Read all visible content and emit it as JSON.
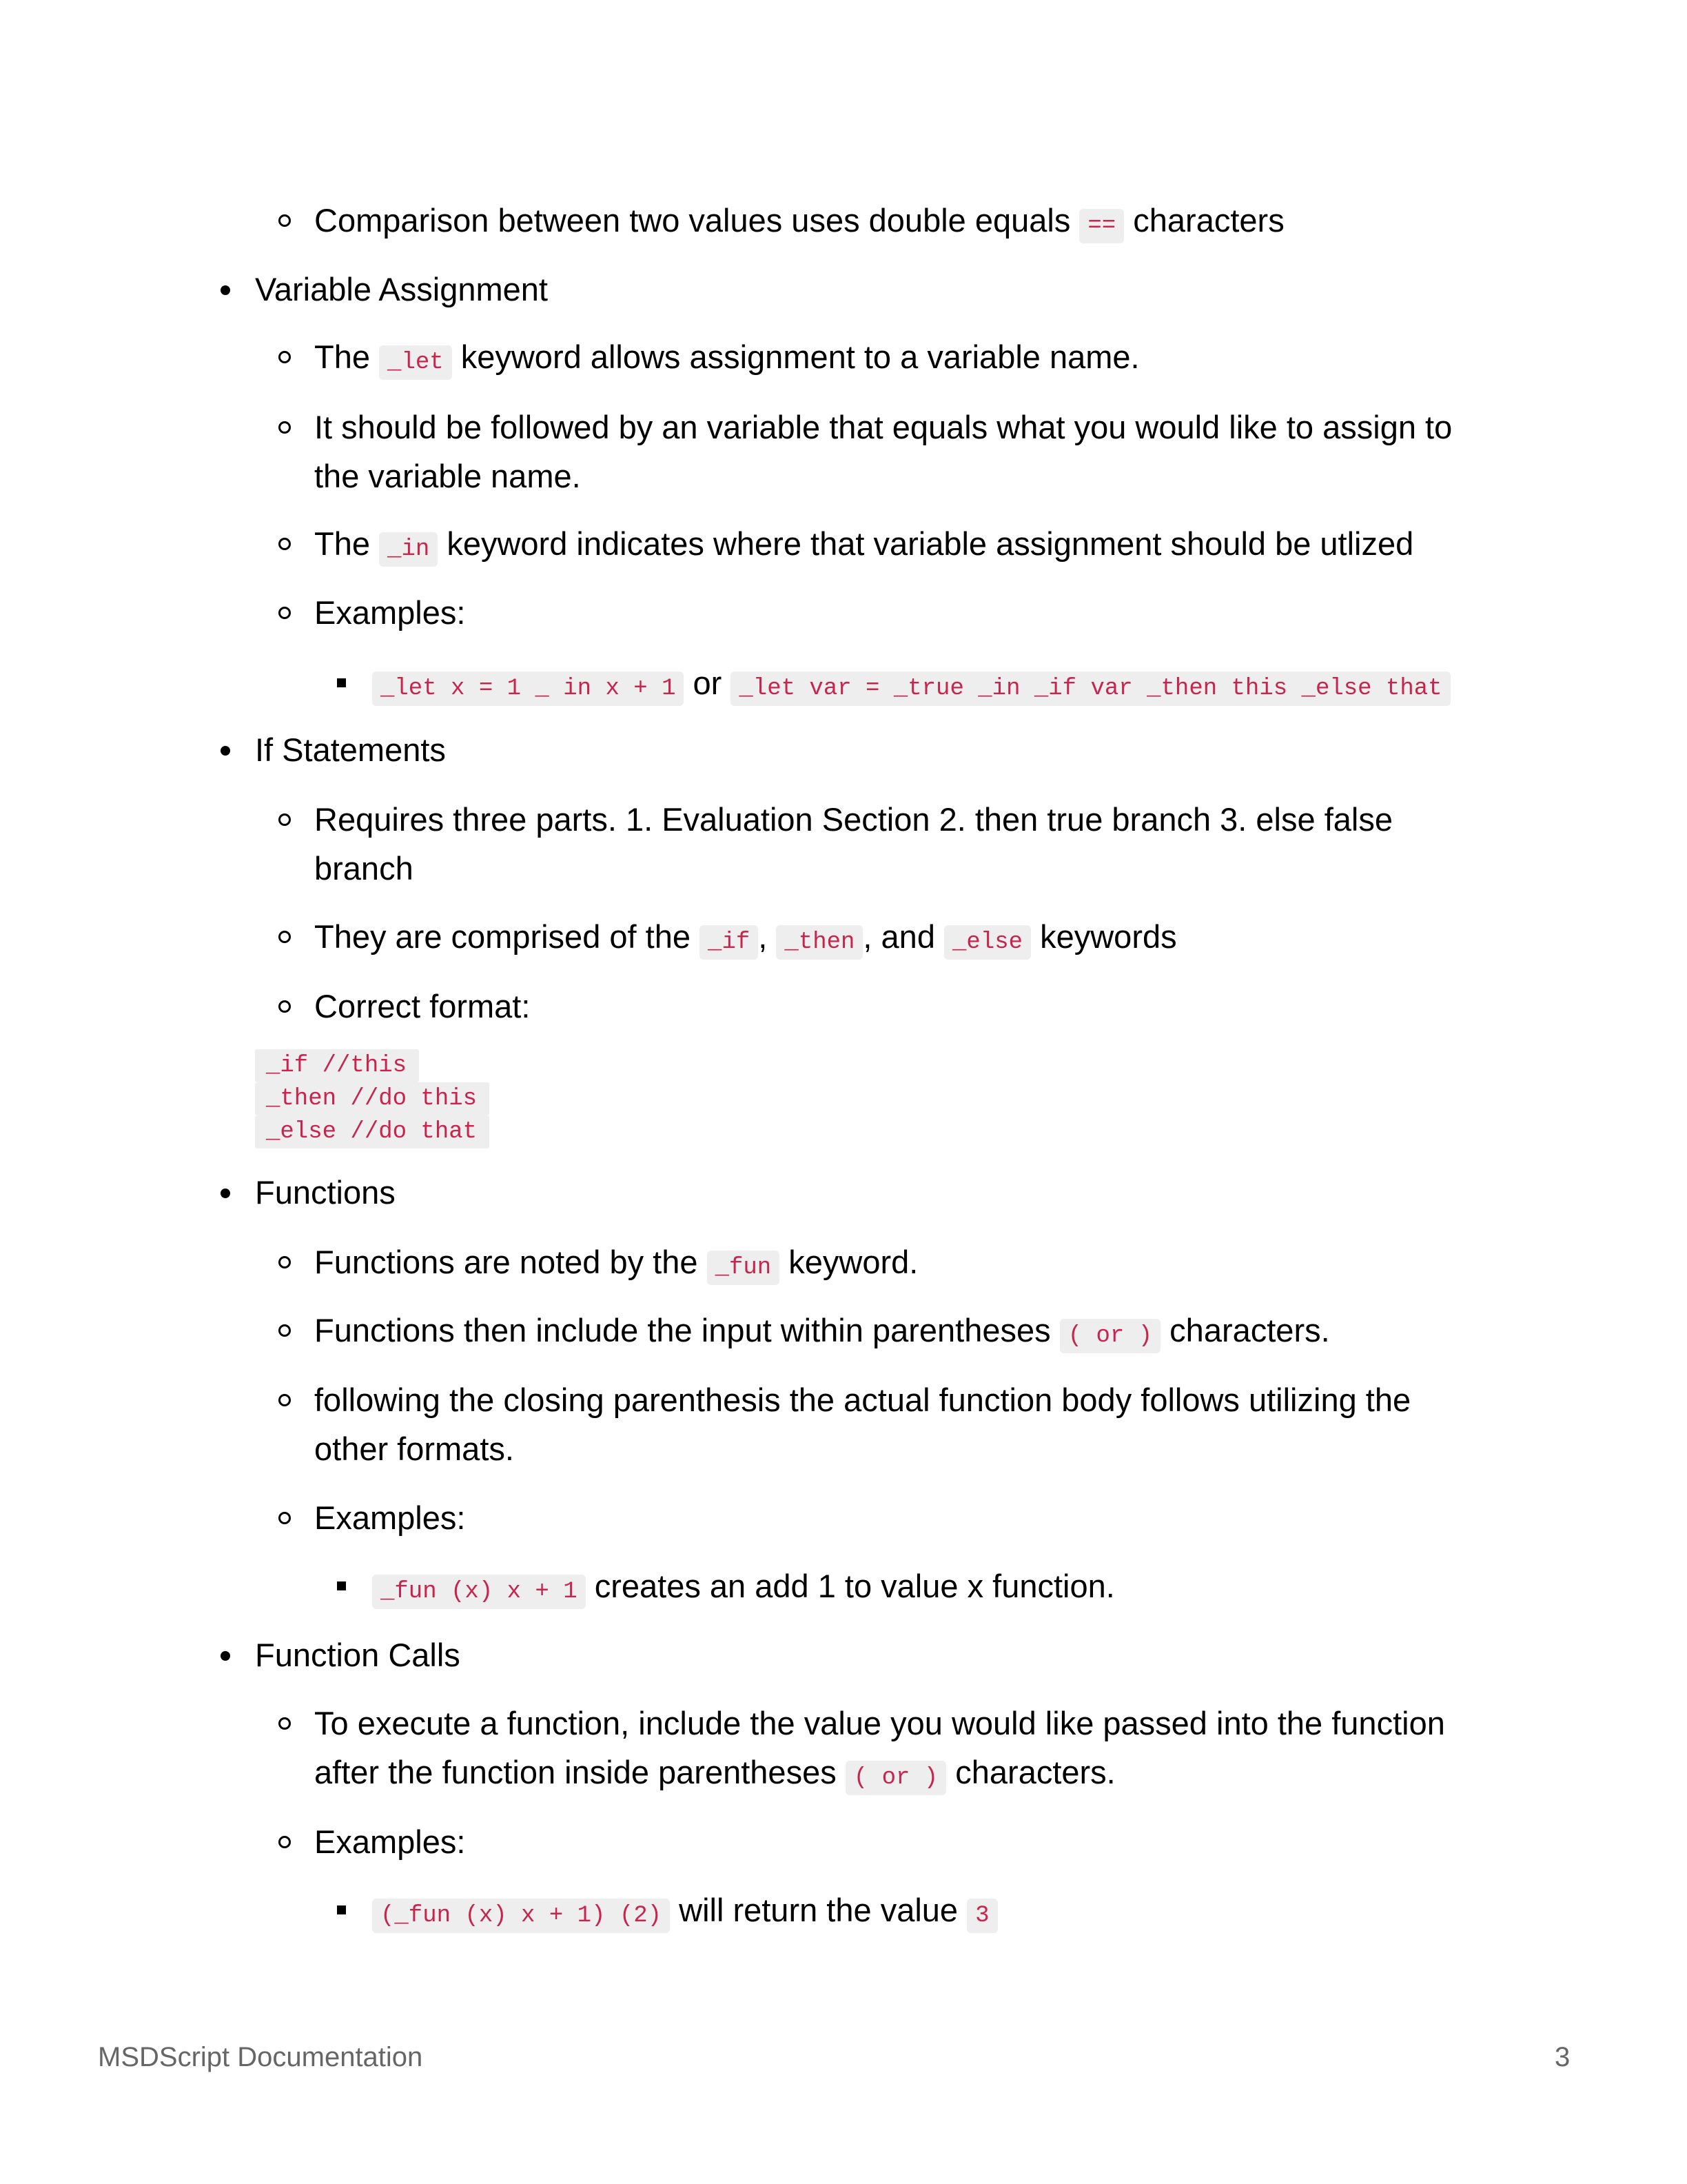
{
  "content": {
    "l1": {
      "a": "Comparison between two values uses double equals ",
      "code": "==",
      "b": " characters"
    },
    "l2": "Variable Assignment",
    "l3": {
      "a": "The ",
      "code": "_let",
      "b": " keyword allows assignment to a variable name."
    },
    "l4": "It should be followed by an variable that equals what you would like to assign to",
    "l5": "the variable name.",
    "l6": {
      "a": "The ",
      "code": "_in",
      "b": " keyword indicates where that variable assignment should be utlized"
    },
    "l7": "Examples:",
    "l8": {
      "code1": "_let x = 1 _ in x + 1",
      "mid": " or ",
      "code2": "_let var = _true _in _if var _then this _else that"
    },
    "l9": "If Statements",
    "l10": "Requires three parts. 1. Evaluation Section 2. then true branch 3. else false",
    "l11": "branch",
    "l12": {
      "a": "They are comprised of the ",
      "code1": "_if",
      "sep1": ", ",
      "code2": "_then",
      "sep2": ", and ",
      "code3": "_else",
      "b": " keywords"
    },
    "l13": "Correct format:",
    "codeblock": [
      "_if //this",
      "_then //do this",
      "_else //do that"
    ],
    "l14": "Functions",
    "l15": {
      "a": "Functions are noted by the ",
      "code": "_fun",
      "b": " keyword."
    },
    "l16": {
      "a": "Functions then include the input within parentheses ",
      "code": "( or )",
      "b": " characters."
    },
    "l17": "following the closing parenthesis the actual function body follows utilizing the",
    "l18": "other formats.",
    "l19": "Examples:",
    "l20": {
      "code": "_fun (x) x + 1",
      "b": " creates an add 1 to value x function."
    },
    "l21": "Function Calls",
    "l22": "To execute a function, include the value you would like passed into the function",
    "l23": {
      "a": "after the function inside parentheses ",
      "code": "( or )",
      "b": " characters."
    },
    "l24": "Examples:",
    "l25": {
      "code1": "(_fun (x) x + 1) (2)",
      "mid": " will return the value ",
      "code2": "3"
    }
  },
  "footer": {
    "title": "MSDScript Documentation",
    "page_number": "3"
  }
}
